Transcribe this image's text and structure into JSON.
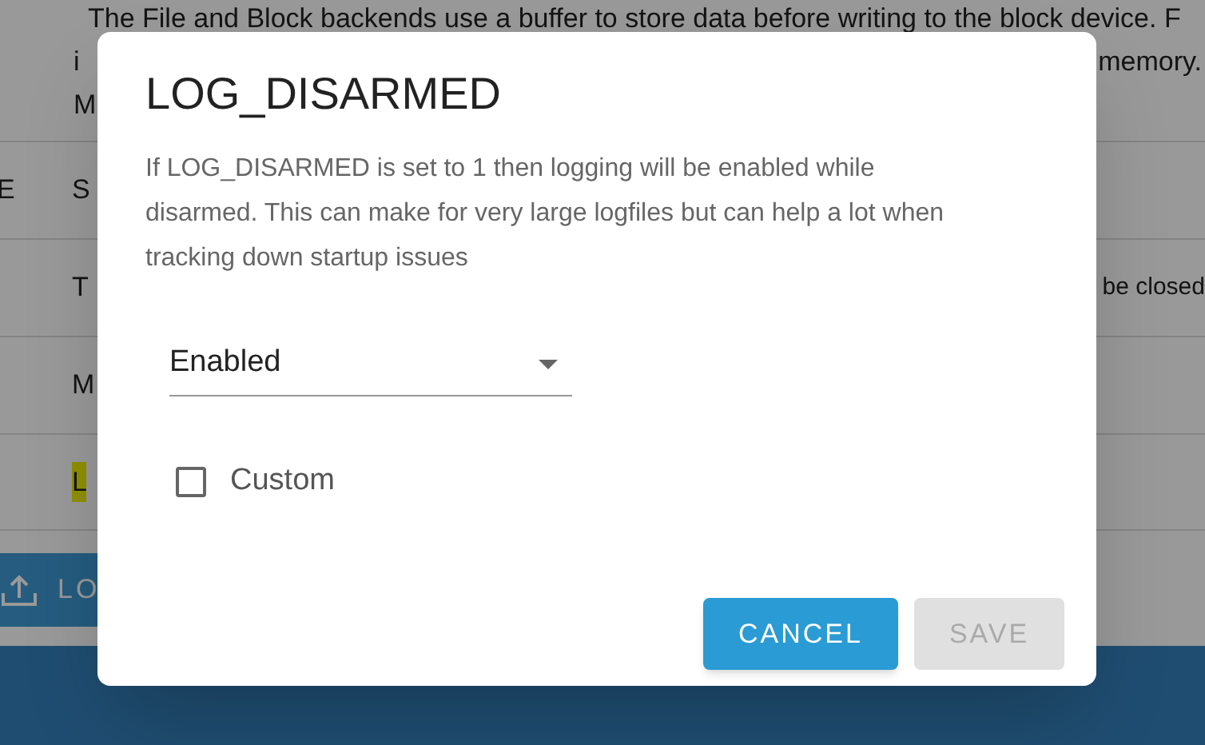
{
  "page_text": [
    {
      "left": "The File and Block backends use a buffer to store data before writing to the block device. F"
    },
    {
      "left": "i",
      "right": "memory."
    },
    {
      "left": "M"
    }
  ],
  "table_rows": [
    {
      "column_1": "E",
      "column_2": "S",
      "highlighted": false
    },
    {
      "column_2": "T",
      "column_3": "be closed",
      "highlighted": false
    },
    {
      "column_2": "M",
      "highlighted": false
    },
    {
      "column_2": "L",
      "highlighted": true
    }
  ],
  "upload_button": {
    "label": "LO"
  },
  "dialog": {
    "title": "LOG_DISARMED",
    "description": "If LOG_DISARMED is set to 1 then logging will be enabled while disarmed. This can make for very large logfiles but can help a lot when tracking down startup issues",
    "select": {
      "value": "Enabled"
    },
    "checkbox": {
      "label": "Custom",
      "checked": false
    },
    "buttons": [
      {
        "label": "CANCEL",
        "disabled": false
      },
      {
        "label": "SAVE",
        "disabled": true
      }
    ]
  }
}
